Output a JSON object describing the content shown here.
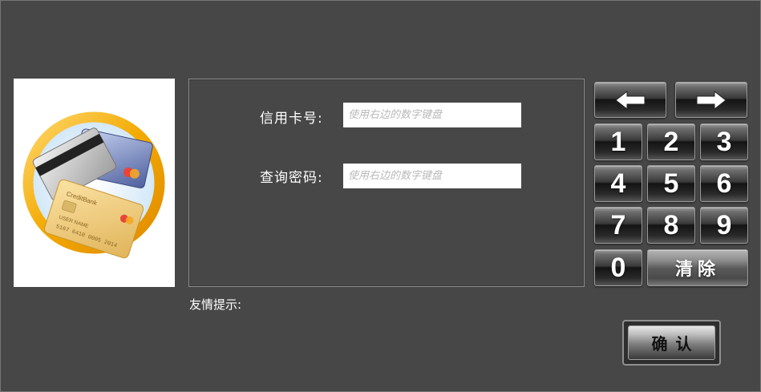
{
  "form": {
    "card_number_label": "信用卡号:",
    "card_number_placeholder": "使用右边的数字键盘",
    "password_label": "查询密码:",
    "password_placeholder": "使用右边的数字键盘",
    "card_number_value": "",
    "password_value": ""
  },
  "hint": {
    "label": "友情提示:",
    "text": ""
  },
  "keypad": {
    "back_icon": "arrow-left-icon",
    "forward_icon": "arrow-right-icon",
    "keys": [
      "1",
      "2",
      "3",
      "4",
      "5",
      "6",
      "7",
      "8",
      "9",
      "0"
    ],
    "clear_label": "清除"
  },
  "confirm_label": "确认",
  "card_image": {
    "brand_text": "CreditBank",
    "holder_text": "USER NAME",
    "number_text": "5167 6410 0005 2014"
  },
  "colors": {
    "background": "#474747",
    "accent_gold": "#f2a900",
    "hint_text": "#ffcc66"
  }
}
